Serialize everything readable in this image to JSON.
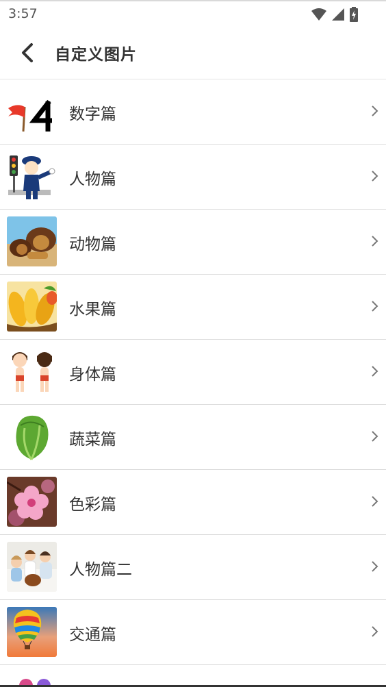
{
  "status_bar": {
    "time": "3:57",
    "icons": [
      "wifi-icon",
      "signal-icon",
      "battery-charging-icon"
    ]
  },
  "header": {
    "title": "自定义图片",
    "back_icon": "back-arrow-icon"
  },
  "list": {
    "items": [
      {
        "label": "数字篇",
        "icon": "flag-number-four-image"
      },
      {
        "label": "人物篇",
        "icon": "traffic-police-image"
      },
      {
        "label": "动物篇",
        "icon": "lions-image"
      },
      {
        "label": "水果篇",
        "icon": "mangoes-image"
      },
      {
        "label": "身体篇",
        "icon": "cartoon-children-image"
      },
      {
        "label": "蔬菜篇",
        "icon": "lettuce-image"
      },
      {
        "label": "色彩篇",
        "icon": "pink-blossom-image"
      },
      {
        "label": "人物篇二",
        "icon": "family-photo-image"
      },
      {
        "label": "交通篇",
        "icon": "hot-air-balloon-image"
      }
    ],
    "chevron_icon": "chevron-right-icon"
  }
}
